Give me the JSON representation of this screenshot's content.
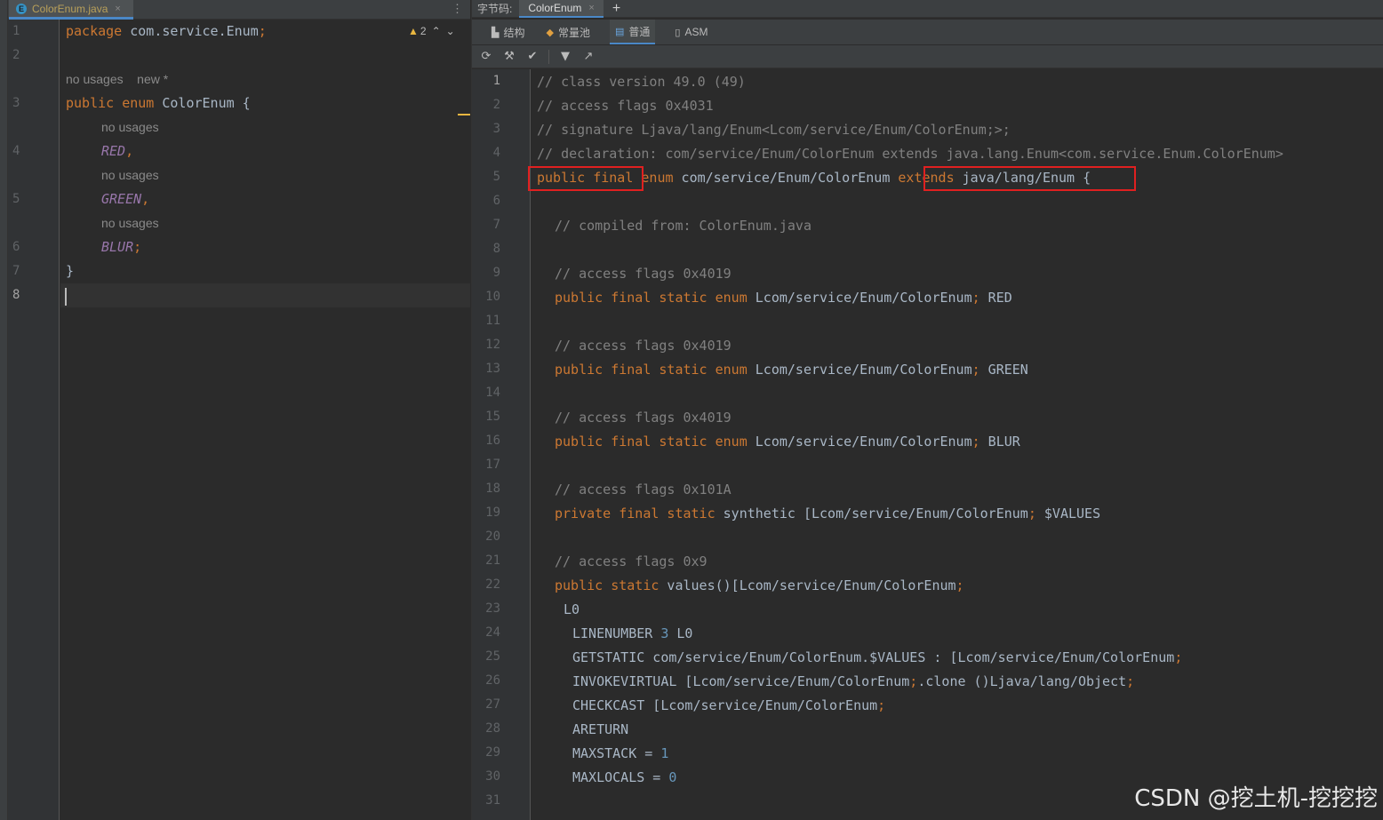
{
  "left_editor": {
    "file_tab": {
      "icon": "enum-file-icon",
      "label": "ColorEnum.java",
      "close": "×"
    },
    "warnings": {
      "count": "2",
      "up": "⌃",
      "down": "⌄"
    },
    "menu": "⋮",
    "line_numbers": [
      "1",
      "2",
      "3",
      "4",
      "5",
      "6",
      "7",
      "8"
    ],
    "code": {
      "package_kw": "package",
      "package_name": " com.service.Enum",
      "semi": ";",
      "usage_hint": "no usages    new *",
      "public_kw": "public",
      "enum_kw": "enum",
      "class_name": " ColorEnum {",
      "const_hint": "no usages",
      "red": "RED",
      "green": "GREEN",
      "blur": "BLUR",
      "comma": ",",
      "close_brace": "}"
    }
  },
  "bytecode_window": {
    "title": "字节码:",
    "tab_label": "ColorEnum",
    "tab_close": "×",
    "add": "+",
    "view_tabs": [
      {
        "icon": "structure-icon",
        "label": "结构"
      },
      {
        "icon": "constant-pool-icon",
        "label": "常量池"
      },
      {
        "icon": "plain-view-icon",
        "label": "普通"
      },
      {
        "icon": "asm-icon",
        "label": "ASM"
      }
    ],
    "toolbar": [
      "refresh-icon",
      "hammer-icon",
      "check-icon",
      "filter-icon",
      "open-external-icon"
    ]
  },
  "bytecode": {
    "line_numbers": [
      "1",
      "2",
      "3",
      "4",
      "5",
      "6",
      "7",
      "8",
      "9",
      "10",
      "11",
      "12",
      "13",
      "14",
      "15",
      "16",
      "17",
      "18",
      "19",
      "20",
      "21",
      "22",
      "23",
      "24",
      "25",
      "26",
      "27",
      "28",
      "29",
      "30",
      "31"
    ],
    "l1": "// class version 49.0 (49)",
    "l2": "// access flags 0x4031",
    "l3": "// signature Ljava/lang/Enum<Lcom/service/Enum/ColorEnum;>;",
    "l4": "// declaration: com/service/Enum/ColorEnum extends java.lang.Enum<com.service.Enum.ColorEnum>",
    "l5_mod": "public final",
    "l5_enum": " enum",
    "l5_name": " com/service/Enum/ColorEnum ",
    "l5_ext": "extends",
    "l5_super": " java/lang/Enum",
    "l5_brace": " {",
    "l7": "// compiled from: ColorEnum.java",
    "l9": "// access flags 0x4019",
    "l10_mod": "public final static enum",
    "l10_rest": " Lcom/service/Enum/ColorEnum",
    "l10_name": " RED",
    "l12": "// access flags 0x4019",
    "l13_mod": "public final static enum",
    "l13_rest": " Lcom/service/Enum/ColorEnum",
    "l13_name": " GREEN",
    "l15": "// access flags 0x4019",
    "l16_mod": "public final static enum",
    "l16_rest": " Lcom/service/Enum/ColorEnum",
    "l16_name": " BLUR",
    "l18": "// access flags 0x101A",
    "l19_mod": "private final static",
    "l19_rest": " synthetic [Lcom/service/Enum/ColorEnum",
    "l19_name": " $VALUES",
    "l21": "// access flags 0x9",
    "l22_mod": "public static",
    "l22_rest": " values()[Lcom/service/Enum/ColorEnum",
    "l23": "L0",
    "l24_a": "LINENUMBER ",
    "l24_n": "3",
    "l24_b": " L0",
    "l25": "GETSTATIC com/service/Enum/ColorEnum.$VALUES : [Lcom/service/Enum/ColorEnum",
    "l26_a": "INVOKEVIRTUAL [Lcom/service/Enum/ColorEnum",
    "l26_b": ".clone ()Ljava/lang/Object",
    "l27": "CHECKCAST [Lcom/service/Enum/ColorEnum",
    "l28": "ARETURN",
    "l29_a": "MAXSTACK = ",
    "l29_n": "1",
    "l30_a": "MAXLOCALS = ",
    "l30_n": "0",
    "semi": ";"
  },
  "watermark": "CSDN @挖土机-挖挖挖",
  "colors": {
    "keyword": "#cc7832",
    "comment": "#808080",
    "number": "#6897bb",
    "enum_constant": "#9876aa",
    "highlight_box": "#e02020"
  }
}
